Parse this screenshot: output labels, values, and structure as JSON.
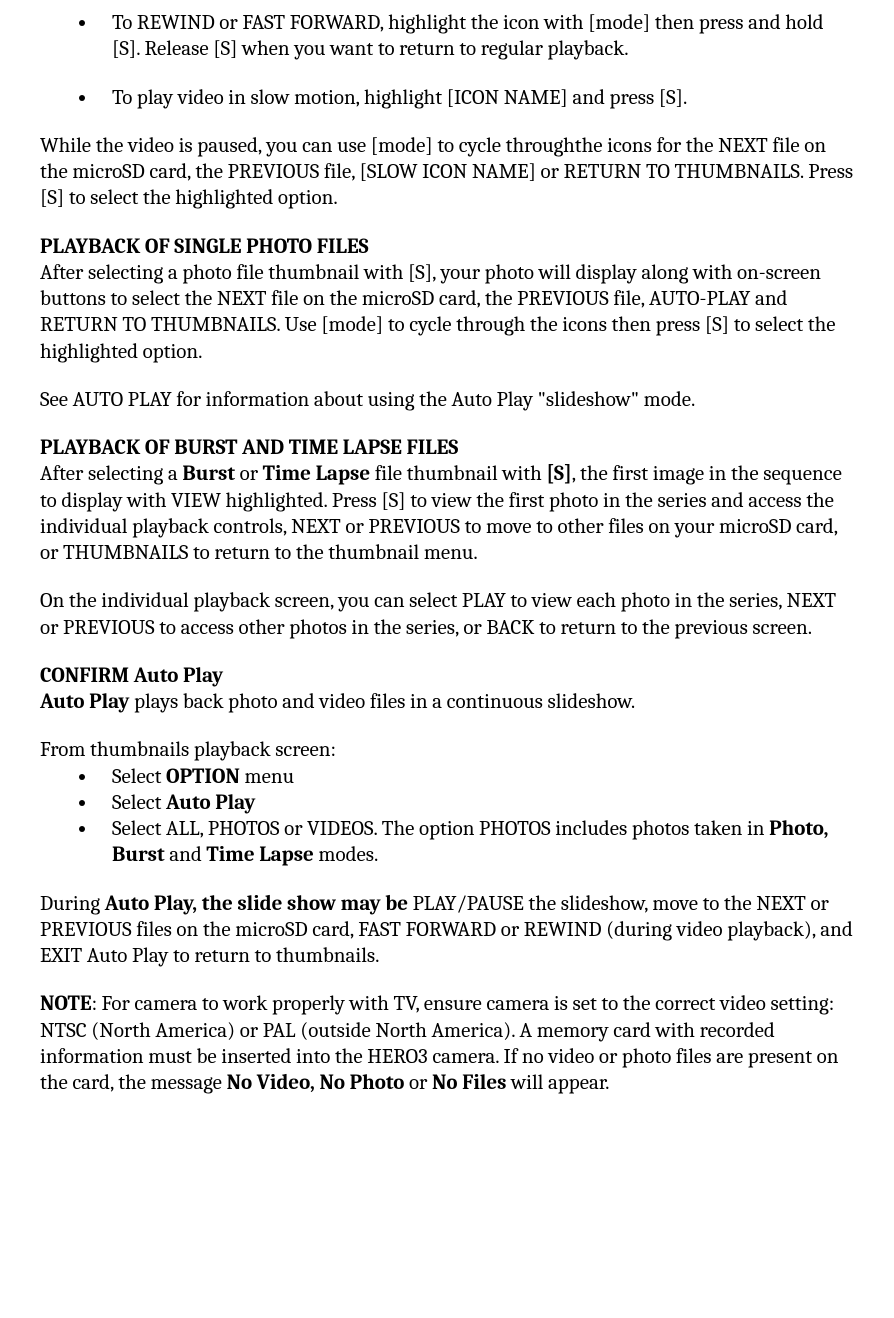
{
  "bullets_top": {
    "b1": "To REWIND or FAST FORWARD, highlight the icon with [mode] then press and hold [S]. Release [S] when you want to return to regular playback.",
    "b2": "To play video in slow motion, highlight [ICON NAME] and press [S]."
  },
  "para_paused": "While the video is paused, you can use [mode] to cycle throughthe icons for the NEXT file on the microSD card, the PREVIOUS file, [SLOW ICON NAME] or RETURN TO THUMBNAILS. Press [S] to select the highlighted option.",
  "heading_single": "PLAYBACK OF SINGLE PHOTO FILES",
  "para_single": "After selecting a photo file thumbnail with [S], your photo will display along with on-screen buttons to select the NEXT file on the microSD card, the PREVIOUS file, AUTO-PLAY and RETURN TO THUMBNAILS. Use [mode] to cycle through the icons then press [S] to select the highlighted option.",
  "para_see_autoplay": "See AUTO PLAY for information about using the Auto Play \"slideshow\" mode.",
  "heading_burst": "PLAYBACK OF BURST AND TIME LAPSE FILES",
  "burst": {
    "pre1": "After selecting a ",
    "b1": "Burst",
    "mid1": " or ",
    "b2": "Time Lapse",
    "mid2": " file thumbnail with ",
    "b3": "[S]",
    "post": ", the first image in the sequence to display with VIEW highlighted. Press [S] to view the first photo in the series and access the individual playback controls, NEXT or PREVIOUS to move to other files on your microSD card, or THUMBNAILS to return to the thumbnail menu."
  },
  "para_individual": "On the individual playback screen, you can select PLAY to view each photo in the series, NEXT or PREVIOUS to access other photos in the series, or BACK to return to the previous screen.",
  "heading_confirm": "CONFIRM Auto Play",
  "autoplay_line": {
    "b1": "Auto Play",
    "rest": " plays back photo and video files in a continuous slideshow."
  },
  "from_thumbs": "From thumbnails playback screen:",
  "steps": {
    "s1_pre": "Select ",
    "s1_b": "OPTION",
    "s1_post": " menu",
    "s2_pre": "Select ",
    "s2_b": "Auto Play",
    "s3_pre": "Select ALL, PHOTOS or VIDEOS. The option PHOTOS includes photos taken in ",
    "s3_b1": "Photo, Burst",
    "s3_mid": " and ",
    "s3_b2": "Time Lapse",
    "s3_post": " modes."
  },
  "during": {
    "pre": "During ",
    "b1": "Auto Play, the slide show may be",
    "post": " PLAY/PAUSE the slideshow, move to the NEXT or PREVIOUS files on the microSD card, FAST FORWARD or REWIND (during video playback), and EXIT Auto Play to return to thumbnails."
  },
  "note": {
    "b1": "NOTE",
    "mid": ": For camera to work properly with TV, ensure camera is set to the correct video setting: NTSC (North America) or PAL (outside North America). A memory card with recorded information must be inserted into the HERO3 camera. If no video or photo files are present on the card, the message ",
    "b2": "No Video, No Photo",
    "mid2": " or ",
    "b3": "No Files",
    "post": " will appear."
  }
}
